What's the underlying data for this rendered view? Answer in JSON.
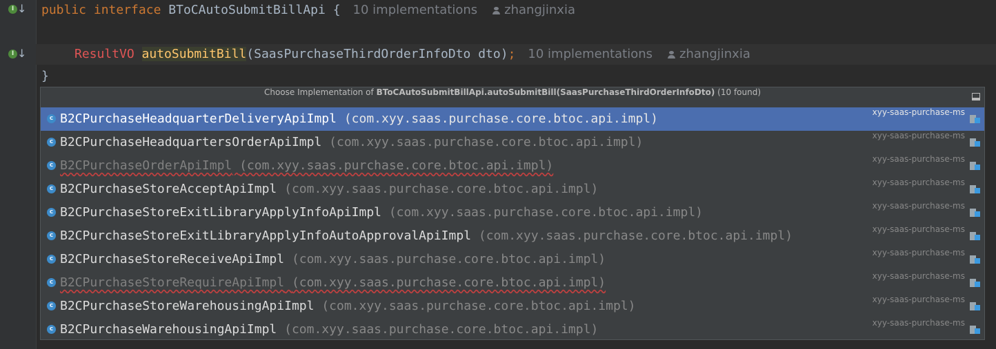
{
  "editor": {
    "line1": {
      "kw1": "public",
      "kw2": "interface",
      "name": "BToCAutoSubmitBillApi",
      "brace": "{",
      "hint_impls": "10 implementations",
      "hint_user": "zhangjinxia"
    },
    "line3": {
      "type": "ResultVO",
      "method": "autoSubmitBill",
      "params": "(SaasPurchaseThirdOrderInfoDto dto)",
      "semi": ";",
      "hint_impls": "10 implementations",
      "hint_user": "zhangjinxia"
    },
    "line4": {
      "brace": "}"
    },
    "gutter_icons": [
      "implemented-interface-icon",
      "implemented-method-icon"
    ]
  },
  "popup": {
    "title_prefix": "Choose Implementation of ",
    "title_target": "BToCAutoSubmitBillApi.autoSubmitBill(SaasPurchaseThirdOrderInfoDto)",
    "title_suffix": " (10 found)",
    "items": [
      {
        "name": "B2CPurchaseHeadquarterDeliveryApiImpl",
        "pkg": "(com.xyy.saas.purchase.core.btoc.api.impl)",
        "module": "xyy-saas-purchase-ms",
        "selected": true,
        "dim": false
      },
      {
        "name": "B2CPurchaseHeadquartersOrderApiImpl",
        "pkg": "(com.xyy.saas.purchase.core.btoc.api.impl)",
        "module": "xyy-saas-purchase-ms",
        "selected": false,
        "dim": false
      },
      {
        "name": "B2CPurchaseOrderApiImpl",
        "pkg": "(com.xyy.saas.purchase.core.btoc.api.impl)",
        "module": "xyy-saas-purchase-ms",
        "selected": false,
        "dim": true
      },
      {
        "name": "B2CPurchaseStoreAcceptApiImpl",
        "pkg": "(com.xyy.saas.purchase.core.btoc.api.impl)",
        "module": "xyy-saas-purchase-ms",
        "selected": false,
        "dim": false
      },
      {
        "name": "B2CPurchaseStoreExitLibraryApplyInfoApiImpl",
        "pkg": "(com.xyy.saas.purchase.core.btoc.api.impl)",
        "module": "xyy-saas-purchase-ms",
        "selected": false,
        "dim": false
      },
      {
        "name": "B2CPurchaseStoreExitLibraryApplyInfoAutoApprovalApiImpl",
        "pkg": "(com.xyy.saas.purchase.core.btoc.api.impl)",
        "module": "xyy-saas-purchase-ms",
        "selected": false,
        "dim": false
      },
      {
        "name": "B2CPurchaseStoreReceiveApiImpl",
        "pkg": "(com.xyy.saas.purchase.core.btoc.api.impl)",
        "module": "xyy-saas-purchase-ms",
        "selected": false,
        "dim": false
      },
      {
        "name": "B2CPurchaseStoreRequireApiImpl",
        "pkg": "(com.xyy.saas.purchase.core.btoc.api.impl)",
        "module": "xyy-saas-purchase-ms",
        "selected": false,
        "dim": true
      },
      {
        "name": "B2CPurchaseStoreWarehousingApiImpl",
        "pkg": "(com.xyy.saas.purchase.core.btoc.api.impl)",
        "module": "xyy-saas-purchase-ms",
        "selected": false,
        "dim": false
      },
      {
        "name": "B2CPurchaseWarehousingApiImpl",
        "pkg": "(com.xyy.saas.purchase.core.btoc.api.impl)",
        "module": "xyy-saas-purchase-ms",
        "selected": false,
        "dim": false
      }
    ]
  }
}
